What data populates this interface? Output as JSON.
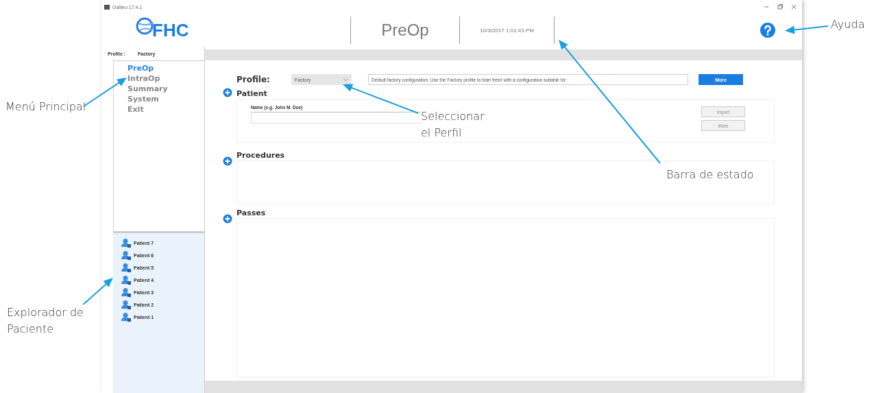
{
  "window": {
    "title": "Galileo 17.4.1"
  },
  "header": {
    "logo": "FHC",
    "page_title": "PreOp",
    "status": "10/3/2017 1:01:43 PM"
  },
  "current_profile": {
    "label": "Profile :",
    "value": "Factory"
  },
  "menu": [
    {
      "label": "PreOp",
      "selected": true
    },
    {
      "label": "IntraOp",
      "selected": false
    },
    {
      "label": "Summary",
      "selected": false
    },
    {
      "label": "System",
      "selected": false
    },
    {
      "label": "Exit",
      "selected": false
    }
  ],
  "patients": [
    "Patient 7",
    "Patient 6",
    "Patient 5",
    "Patient 4",
    "Patient 3",
    "Patient 2",
    "Patient 1"
  ],
  "profile": {
    "label": "Profile:",
    "value": "Factory",
    "description": "Default factory configuration. Use the Factory profile to start fresh with a configuration suitable for :",
    "button": "More"
  },
  "sections": [
    {
      "title": "Patient",
      "field_label": "Name (e.g. John M. Doe)",
      "buttons": [
        "Import",
        "More"
      ]
    },
    {
      "title": "Procedures"
    },
    {
      "title": "Passes"
    }
  ],
  "annotations": [
    "Ayuda",
    "Menú Principal",
    "Seleccionar el Perfil",
    "Barra de estado",
    "Explorador de Paciente"
  ]
}
